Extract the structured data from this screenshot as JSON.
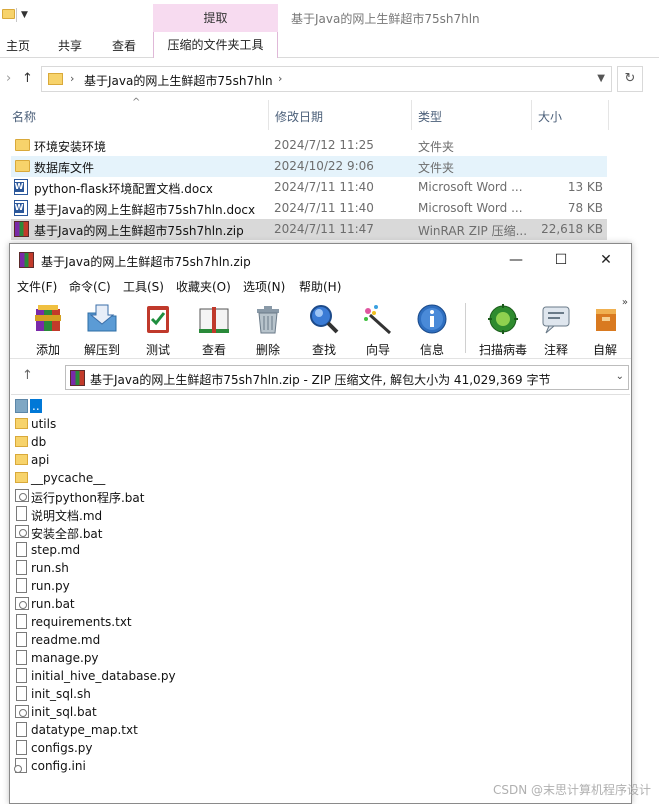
{
  "explorer": {
    "window_title": "基于Java的网上生鲜超市75sh7hln",
    "context_tab_header": "提取",
    "tabs": [
      "主页",
      "共享",
      "查看",
      "压缩的文件夹工具"
    ],
    "address": {
      "path": "基于Java的网上生鲜超市75sh7hln"
    },
    "columns": {
      "name": "名称",
      "date": "修改日期",
      "type": "类型",
      "size": "大小"
    },
    "files": [
      {
        "name": "环境安装环境",
        "date": "2024/7/12 11:25",
        "type": "文件夹",
        "size": "",
        "icon": "folder-icon",
        "state": "normal"
      },
      {
        "name": "数据库文件",
        "date": "2024/10/22 9:06",
        "type": "文件夹",
        "size": "",
        "icon": "folder-icon",
        "state": "hover"
      },
      {
        "name": "python-flask环境配置文档.docx",
        "date": "2024/7/11 11:40",
        "type": "Microsoft Word ...",
        "size": "13 KB",
        "icon": "word-doc-icon",
        "state": "normal"
      },
      {
        "name": "基于Java的网上生鲜超市75sh7hln.docx",
        "date": "2024/7/11 11:40",
        "type": "Microsoft Word ...",
        "size": "78 KB",
        "icon": "word-doc-icon",
        "state": "normal"
      },
      {
        "name": "基于Java的网上生鲜超市75sh7hln.zip",
        "date": "2024/7/11 11:47",
        "type": "WinRAR ZIP 压缩...",
        "size": "22,618 KB",
        "icon": "winrar-archive-icon",
        "state": "selected"
      }
    ]
  },
  "winrar": {
    "title": "基于Java的网上生鲜超市75sh7hln.zip",
    "window_buttons": {
      "minimize": "—",
      "maximize": "☐",
      "close": "✕"
    },
    "menu": [
      "文件(F)",
      "命令(C)",
      "工具(S)",
      "收藏夹(O)",
      "选项(N)",
      "帮助(H)"
    ],
    "toolbar": [
      {
        "label": "添加",
        "icon": "add-archive-icon"
      },
      {
        "label": "解压到",
        "icon": "extract-to-icon"
      },
      {
        "label": "测试",
        "icon": "test-icon"
      },
      {
        "label": "查看",
        "icon": "view-book-icon"
      },
      {
        "label": "删除",
        "icon": "delete-trash-icon"
      },
      {
        "label": "查找",
        "icon": "find-magnifier-icon"
      },
      {
        "label": "向导",
        "icon": "wizard-wand-icon"
      },
      {
        "label": "信息",
        "icon": "info-icon"
      },
      {
        "label": "扫描病毒",
        "icon": "virus-scan-icon"
      },
      {
        "label": "注释",
        "icon": "comment-icon"
      },
      {
        "label": "自解",
        "icon": "sfx-icon"
      }
    ],
    "toolbar_more": "»",
    "address_path": "基于Java的网上生鲜超市75sh7hln.zip - ZIP 压缩文件, 解包大小为 41,029,369 字节",
    "entries": [
      {
        "name": "..",
        "icon": "parent-folder-icon",
        "kind": "up"
      },
      {
        "name": "utils",
        "icon": "folder-icon",
        "kind": "folder"
      },
      {
        "name": "db",
        "icon": "folder-icon",
        "kind": "folder"
      },
      {
        "name": "api",
        "icon": "folder-icon",
        "kind": "folder"
      },
      {
        "name": "__pycache__",
        "icon": "folder-icon",
        "kind": "folder"
      },
      {
        "name": "运行python程序.bat",
        "icon": "batch-file-icon",
        "kind": "bat"
      },
      {
        "name": "说明文档.md",
        "icon": "document-icon",
        "kind": "doc"
      },
      {
        "name": "安装全部.bat",
        "icon": "batch-file-icon",
        "kind": "bat"
      },
      {
        "name": "step.md",
        "icon": "document-icon",
        "kind": "doc"
      },
      {
        "name": "run.sh",
        "icon": "document-icon",
        "kind": "doc"
      },
      {
        "name": "run.py",
        "icon": "document-icon",
        "kind": "doc"
      },
      {
        "name": "run.bat",
        "icon": "batch-file-icon",
        "kind": "bat"
      },
      {
        "name": "requirements.txt",
        "icon": "document-icon",
        "kind": "doc"
      },
      {
        "name": "readme.md",
        "icon": "document-icon",
        "kind": "doc"
      },
      {
        "name": "manage.py",
        "icon": "document-icon",
        "kind": "doc"
      },
      {
        "name": "initial_hive_database.py",
        "icon": "document-icon",
        "kind": "doc"
      },
      {
        "name": "init_sql.sh",
        "icon": "document-icon",
        "kind": "doc"
      },
      {
        "name": "init_sql.bat",
        "icon": "batch-file-icon",
        "kind": "bat"
      },
      {
        "name": "datatype_map.txt",
        "icon": "document-icon",
        "kind": "doc"
      },
      {
        "name": "configs.py",
        "icon": "document-icon",
        "kind": "doc"
      },
      {
        "name": "config.ini",
        "icon": "settings-file-icon",
        "kind": "ini"
      }
    ]
  },
  "watermark": "CSDN @末思计算机程序设计"
}
